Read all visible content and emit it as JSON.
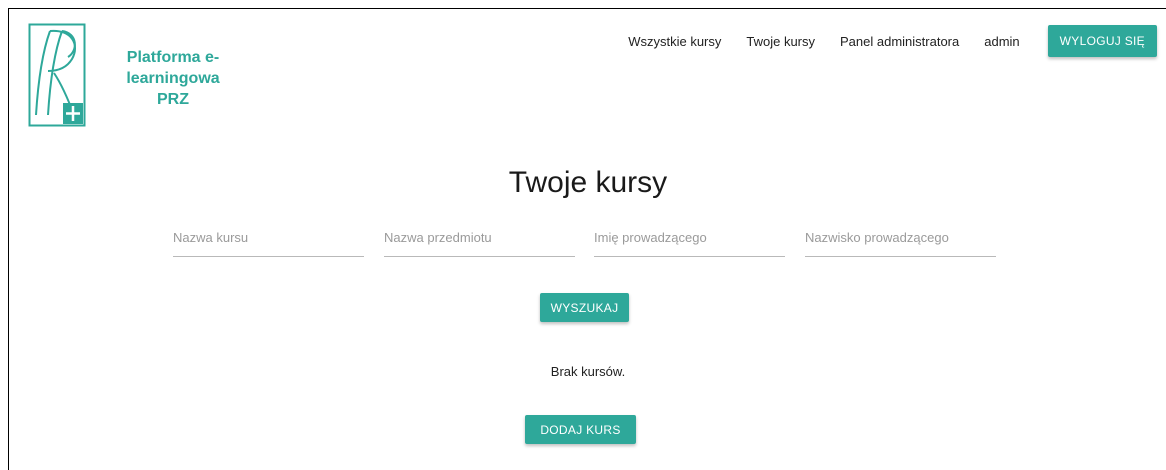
{
  "brand": {
    "logo_icon": "prz-logo-icon",
    "name_line1": "Platforma e-learningowa",
    "name_line2": "PRZ",
    "color": "#2ea89a"
  },
  "nav": {
    "all_courses": "Wszystkie kursy",
    "your_courses": "Twoje kursy",
    "admin_panel": "Panel administratora",
    "user": "admin",
    "logout": "WYLOGUJ SIĘ"
  },
  "main": {
    "title": "Twoje kursy",
    "filters": {
      "course_name": "Nazwa kursu",
      "subject_name": "Nazwa przedmiotu",
      "teacher_first_name": "Imię prowadzącego",
      "teacher_last_name": "Nazwisko prowadzącego"
    },
    "search_button": "WYSZUKAJ",
    "empty_message": "Brak kursów.",
    "add_course_button": "DODAJ KURS"
  },
  "colors": {
    "accent": "#2ea89a"
  }
}
